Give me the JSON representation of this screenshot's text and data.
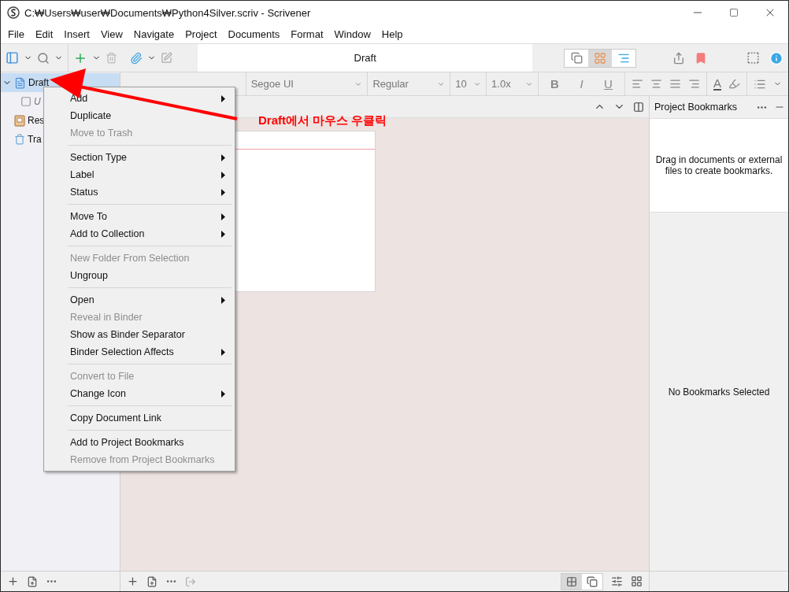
{
  "window": {
    "title": "C:₩Users₩user₩Documents₩Python4Silver.scriv - Scrivener"
  },
  "menu_bar": [
    "File",
    "Edit",
    "Insert",
    "View",
    "Navigate",
    "Project",
    "Documents",
    "Format",
    "Window",
    "Help"
  ],
  "toolbar": {
    "document_title": "Draft"
  },
  "view_modes": [
    {
      "kind": "scrivenings",
      "selected": false
    },
    {
      "kind": "corkboard",
      "selected": true
    },
    {
      "kind": "outliner",
      "selected": false
    }
  ],
  "binder": {
    "items": [
      {
        "label": "Draft",
        "kind": "draft",
        "selected": true,
        "expanded": true,
        "children": [
          {
            "label": "U",
            "kind": "document",
            "selected": false
          }
        ]
      },
      {
        "label": "Res",
        "kind": "research",
        "selected": false
      },
      {
        "label": "Tra",
        "kind": "trash",
        "selected": false
      }
    ]
  },
  "format_bar": {
    "font": "Segoe UI",
    "style": "Regular",
    "size": "10",
    "spacing": "1.0x",
    "buttons": [
      "B",
      "I",
      "U"
    ],
    "text_color": "A"
  },
  "inspector": {
    "title": "Project Bookmarks",
    "hint": "Drag in documents or external files to create bookmarks.",
    "empty_message": "No Bookmarks Selected"
  },
  "context_menu": {
    "groups": [
      [
        {
          "label": "Add",
          "disabled": false,
          "submenu": true
        },
        {
          "label": "Duplicate",
          "disabled": false,
          "submenu": false
        },
        {
          "label": "Move to Trash",
          "disabled": true,
          "submenu": false
        }
      ],
      [
        {
          "label": "Section Type",
          "disabled": false,
          "submenu": true
        },
        {
          "label": "Label",
          "disabled": false,
          "submenu": true
        },
        {
          "label": "Status",
          "disabled": false,
          "submenu": true
        }
      ],
      [
        {
          "label": "Move To",
          "disabled": false,
          "submenu": true
        },
        {
          "label": "Add to Collection",
          "disabled": false,
          "submenu": true
        }
      ],
      [
        {
          "label": "New Folder From Selection",
          "disabled": true,
          "submenu": false
        },
        {
          "label": "Ungroup",
          "disabled": false,
          "submenu": false
        }
      ],
      [
        {
          "label": "Open",
          "disabled": false,
          "submenu": true
        },
        {
          "label": "Reveal in Binder",
          "disabled": true,
          "submenu": false
        },
        {
          "label": "Show as Binder Separator",
          "disabled": false,
          "submenu": false
        },
        {
          "label": "Binder Selection Affects",
          "disabled": false,
          "submenu": true
        }
      ],
      [
        {
          "label": "Convert to File",
          "disabled": true,
          "submenu": false
        },
        {
          "label": "Change Icon",
          "disabled": false,
          "submenu": true
        }
      ],
      [
        {
          "label": "Copy Document Link",
          "disabled": false,
          "submenu": false
        }
      ],
      [
        {
          "label": "Add to Project Bookmarks",
          "disabled": false,
          "submenu": false
        },
        {
          "label": "Remove from Project Bookmarks",
          "disabled": true,
          "submenu": false
        }
      ]
    ]
  },
  "footer_view_modes": [
    {
      "kind": "grid",
      "selected": true
    },
    {
      "kind": "freeform",
      "selected": false
    }
  ],
  "annotation": {
    "text": "Draft에서 마우스 우클릭"
  }
}
